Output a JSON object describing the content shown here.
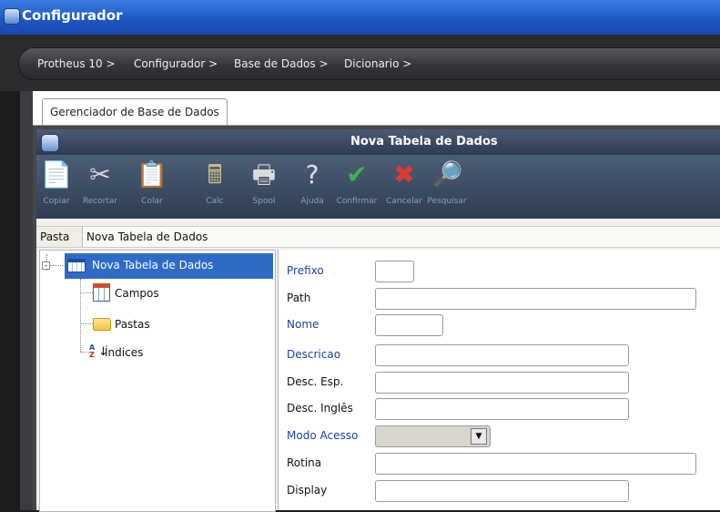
{
  "window": {
    "title": "Configurador"
  },
  "breadcrumb": [
    "Protheus 10 >",
    "Configurador >",
    "Base de Dados >",
    "Dicionario >"
  ],
  "tabs": [
    {
      "label": "Gerenciador de Base de Dados"
    }
  ],
  "dialog": {
    "title": "Nova Tabela de Dados"
  },
  "toolbar": [
    {
      "label": "Copiar",
      "icon": "copy-icon"
    },
    {
      "label": "Recortar",
      "icon": "scissors-icon"
    },
    {
      "label": "Colar",
      "icon": "paste-icon"
    },
    {
      "label": "Calc",
      "icon": "calculator-icon"
    },
    {
      "label": "Spool",
      "icon": "printer-icon"
    },
    {
      "label": "Ajuda",
      "icon": "help-icon"
    },
    {
      "label": "Confirmar",
      "icon": "check-icon"
    },
    {
      "label": "Cancelar",
      "icon": "cancel-icon"
    },
    {
      "label": "Pesquisar",
      "icon": "search-icon"
    }
  ],
  "pasta": {
    "label": "Pasta",
    "value": "Nova Tabela de Dados"
  },
  "tree": {
    "root": {
      "label": "Nova Tabela de Dados",
      "icon": "table-icon"
    },
    "children": [
      {
        "label": "Campos",
        "icon": "fields-icon"
      },
      {
        "label": "Pastas",
        "icon": "folder-icon"
      },
      {
        "label": "Índices",
        "icon": "sort-az-icon"
      }
    ]
  },
  "form": {
    "fields": [
      {
        "label": "Prefixo",
        "value": "",
        "required": true
      },
      {
        "label": "Path",
        "value": "",
        "required": false
      },
      {
        "label": "Nome",
        "value": "",
        "required": true
      },
      {
        "label": "Descricao",
        "value": "",
        "required": true
      },
      {
        "label": "Desc. Esp.",
        "value": "",
        "required": false
      },
      {
        "label": "Desc. Inglês",
        "value": "",
        "required": false
      },
      {
        "label": "Modo Acesso",
        "value": "",
        "required": true
      },
      {
        "label": "Rotina",
        "value": "",
        "required": false
      },
      {
        "label": "Display",
        "value": "",
        "required": false
      }
    ]
  },
  "colors": {
    "titlebar": "#1c55c4",
    "selection": "#2e6bc6",
    "required_label": "#1a3fa8"
  }
}
